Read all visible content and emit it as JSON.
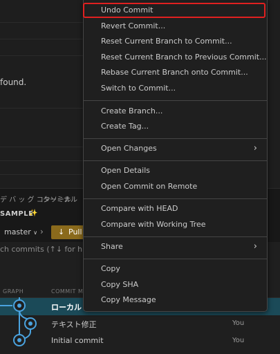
{
  "background": {
    "found_text": "found.",
    "panel_tabs": [
      "デ バ ッ グ コンソール",
      "ターミナル"
    ],
    "repo_title": "SAMPLE",
    "sparkle_icon": "sparkle-icon",
    "branch": "master",
    "branch_chevron": "∨",
    "pull_label": "Pull",
    "search_placeholder": "ch commits (↑↓ for history)",
    "graph_header": {
      "graph": "GRAPH",
      "commit_message": "COMMIT ME"
    }
  },
  "commits": [
    {
      "message": "ローカル",
      "author": "",
      "selected": true
    },
    {
      "message": "テキスト修正",
      "author": "You",
      "selected": false
    },
    {
      "message": "Initial commit",
      "author": "You",
      "selected": false
    }
  ],
  "menu": {
    "groups": [
      [
        "Undo Commit",
        "Revert Commit...",
        "Reset Current Branch to Commit...",
        "Reset Current Branch to Previous Commit...",
        "Rebase Current Branch onto Commit...",
        "Switch to Commit..."
      ],
      [
        "Create Branch...",
        "Create Tag..."
      ],
      [
        "Open Changes"
      ],
      [
        "Open Details",
        "Open Commit on Remote"
      ],
      [
        "Compare with HEAD",
        "Compare with Working Tree"
      ],
      [
        "Share"
      ],
      [
        "Copy",
        "Copy SHA",
        "Copy Message"
      ]
    ],
    "submenu_items": [
      "Open Changes",
      "Share"
    ],
    "highlighted_item": "Undo Commit"
  },
  "colors": {
    "highlight_border": "#e02020",
    "selected_row": "#1b4a58",
    "graph_line": "#4aa3df",
    "pull_button": "#8a6a1c"
  }
}
